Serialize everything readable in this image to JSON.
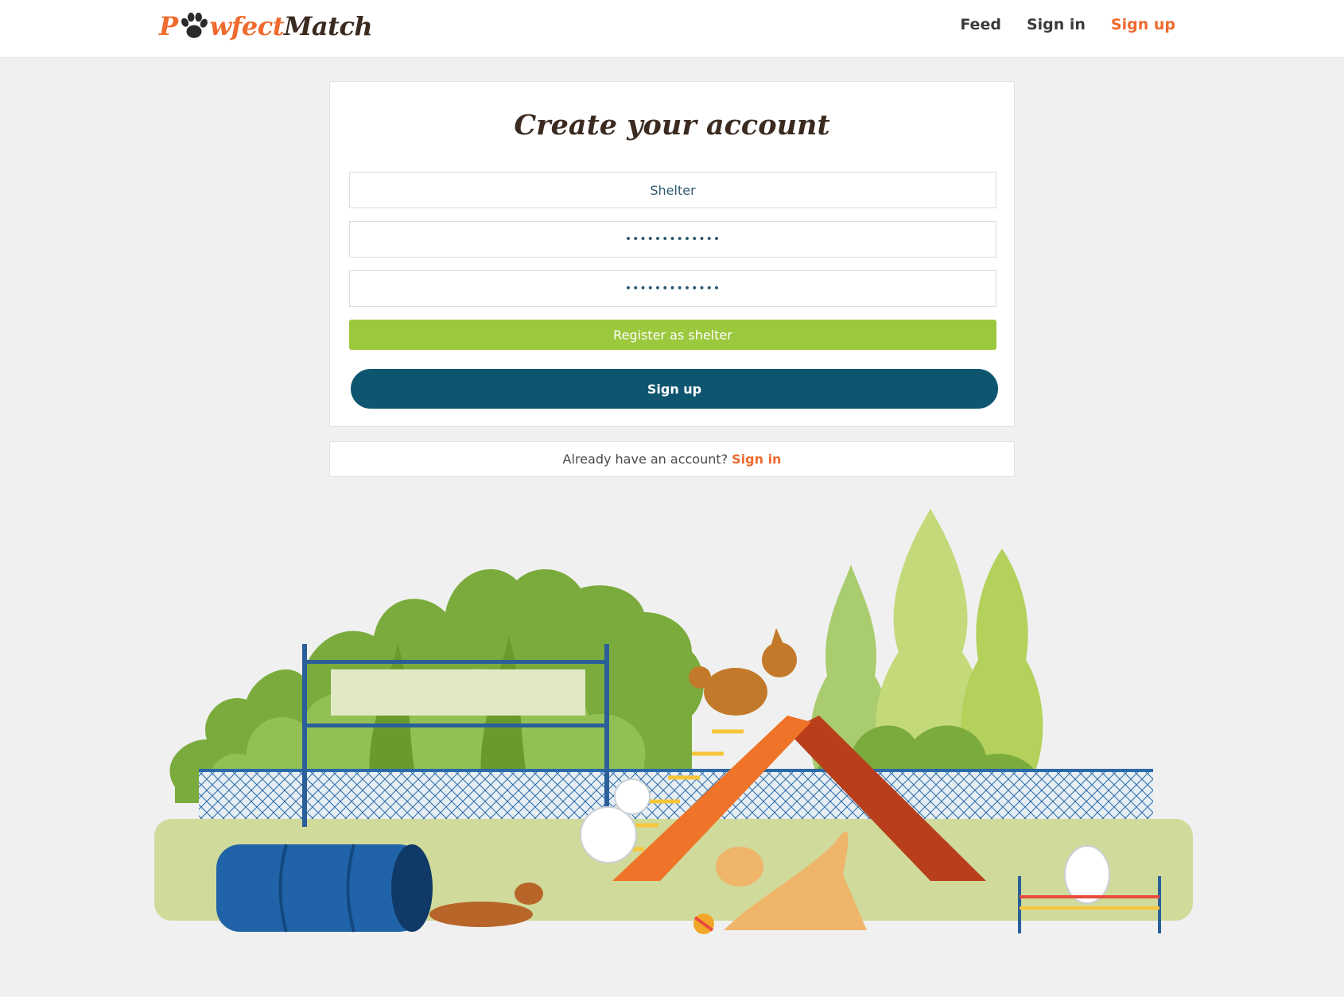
{
  "header": {
    "logo": {
      "part1": "P",
      "paw_icon": "paw-icon",
      "part2": "wfect",
      "part3": "Match"
    },
    "nav": [
      {
        "label": "Feed",
        "active": false
      },
      {
        "label": "Sign in",
        "active": false
      },
      {
        "label": "Sign up",
        "active": true
      }
    ]
  },
  "form": {
    "title": "Create your account",
    "username_value": "Shelter",
    "password_value": "•••••••••••••",
    "confirm_password_value": "•••••••••••••",
    "register_shelter_label": "Register as shelter",
    "signup_label": "Sign up"
  },
  "footer_prompt": {
    "text": "Already have an account?",
    "link": "Sign in"
  },
  "colors": {
    "accent_orange": "#ef6a2e",
    "shelter_green": "#9bc83c",
    "signup_blue": "#0e5670",
    "title_brown": "#3a2a20"
  }
}
